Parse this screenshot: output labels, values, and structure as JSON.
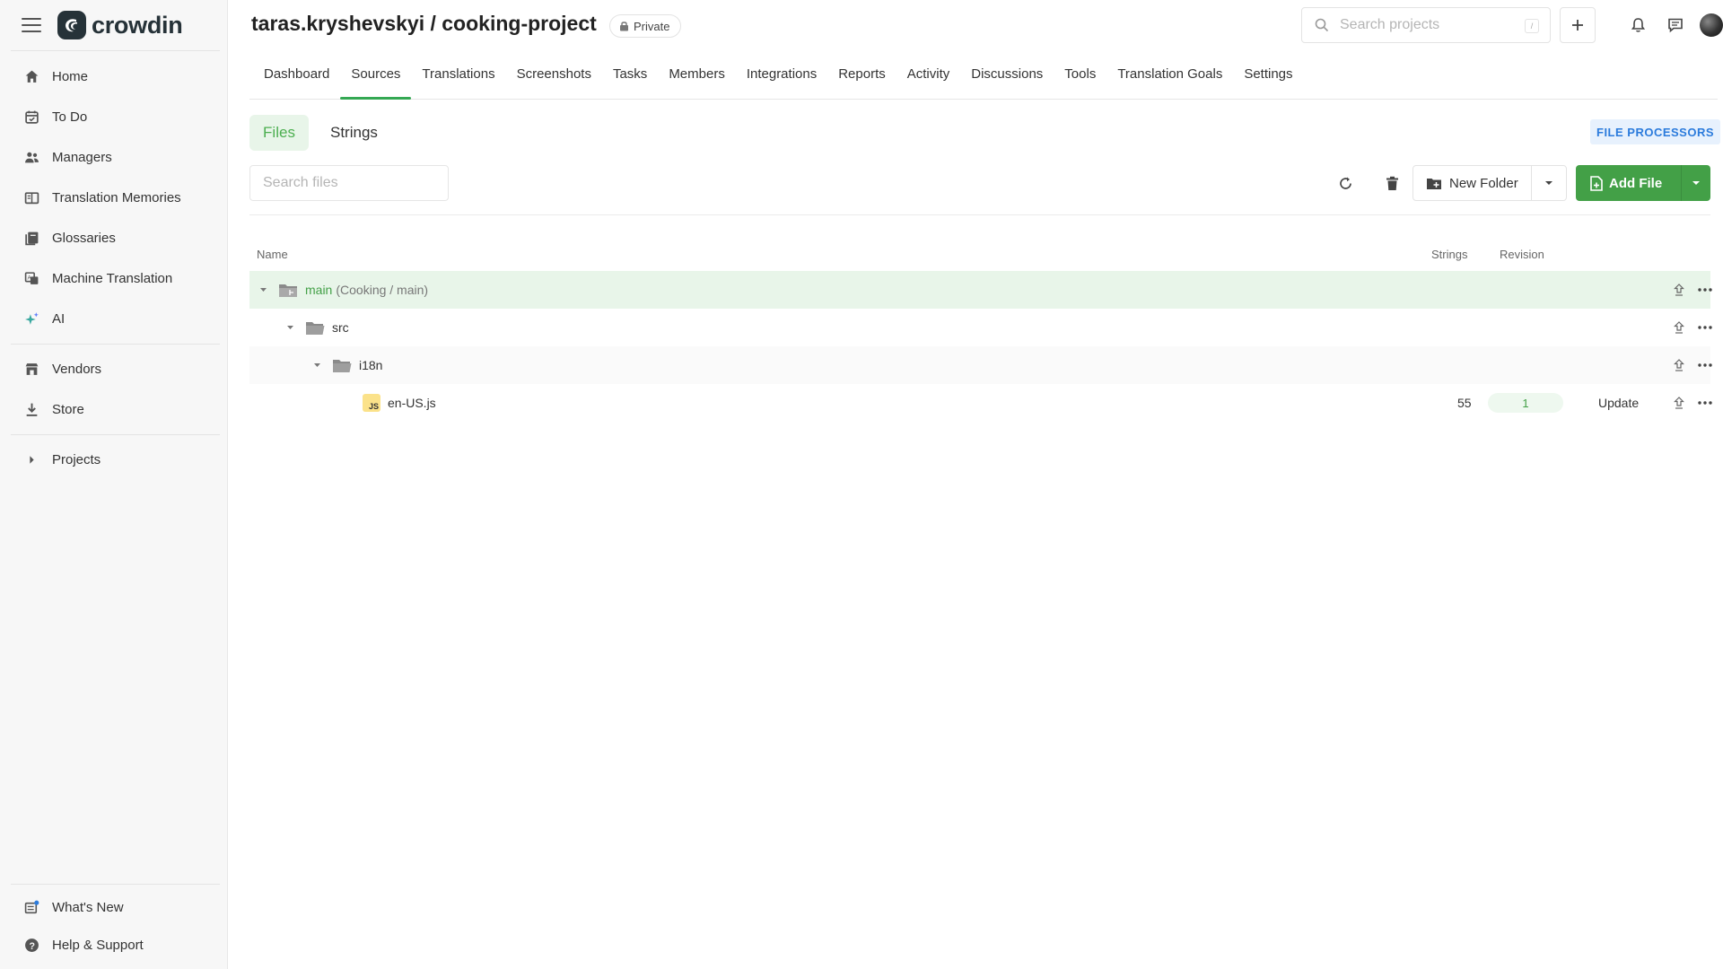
{
  "app": {
    "brand": "crowdin"
  },
  "sidebar": {
    "items": [
      {
        "label": "Home",
        "icon": "home-icon"
      },
      {
        "label": "To Do",
        "icon": "calendar-icon"
      },
      {
        "label": "Managers",
        "icon": "users-icon"
      },
      {
        "label": "Translation Memories",
        "icon": "book-icon"
      },
      {
        "label": "Glossaries",
        "icon": "glossary-icon"
      },
      {
        "label": "Machine Translation",
        "icon": "machine-translation-icon"
      },
      {
        "label": "AI",
        "icon": "sparkles-icon"
      },
      {
        "label": "Vendors",
        "icon": "store-icon"
      },
      {
        "label": "Store",
        "icon": "download-icon"
      },
      {
        "label": "Projects",
        "icon": "chevron-right-icon"
      }
    ],
    "bottom": [
      {
        "label": "What's New",
        "icon": "news-icon"
      },
      {
        "label": "Help & Support",
        "icon": "help-icon"
      }
    ]
  },
  "topbar": {
    "project_title": "taras.kryshevskyi / cooking-project",
    "privacy": "Private",
    "search_placeholder": "Search projects",
    "search_shortcut": "/"
  },
  "nav": {
    "tabs": [
      "Dashboard",
      "Sources",
      "Translations",
      "Screenshots",
      "Tasks",
      "Members",
      "Integrations",
      "Reports",
      "Activity",
      "Discussions",
      "Tools",
      "Translation Goals",
      "Settings"
    ],
    "active": "Sources"
  },
  "subtabs": {
    "files": "Files",
    "strings": "Strings",
    "file_processors": "FILE PROCESSORS"
  },
  "toolbar": {
    "search_placeholder": "Search files",
    "new_folder": "New Folder",
    "add_file": "Add File"
  },
  "table": {
    "columns": {
      "name": "Name",
      "strings": "Strings",
      "revision": "Revision"
    },
    "rows": [
      {
        "name": "main",
        "sub": "(Cooking / main)",
        "type": "branch",
        "level": 0
      },
      {
        "name": "src",
        "type": "folder",
        "level": 1
      },
      {
        "name": "i18n",
        "type": "folder",
        "level": 2
      },
      {
        "name": "en-US.js",
        "type": "file",
        "level": 3,
        "strings": "55",
        "revision": "1",
        "action": "Update",
        "badge": "JS"
      }
    ]
  },
  "colors": {
    "accent": "#43a047",
    "accent_light": "#e8f5e9",
    "link_blue": "#2b7bdc"
  }
}
